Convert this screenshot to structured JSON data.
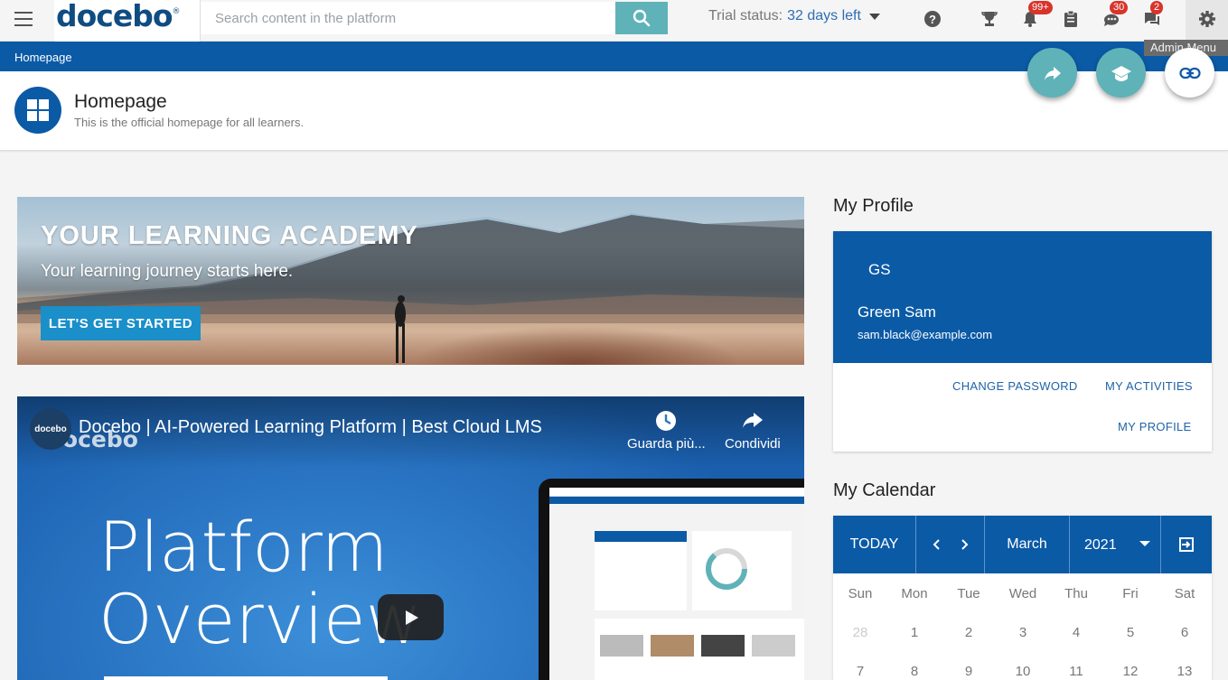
{
  "topbar": {
    "logo": "docebo",
    "logo_mark": "®",
    "search_placeholder": "Search content in the platform",
    "trial_label": "Trial status:",
    "trial_days": "32 days left",
    "badges": {
      "notifications": "99+",
      "chat": "30",
      "messages": "2"
    },
    "admin_tooltip": "Admin Menu"
  },
  "breadcrumb": {
    "home": "Homepage"
  },
  "header": {
    "title": "Homepage",
    "subtitle": "This is the official homepage for all learners."
  },
  "banner": {
    "title": "YOUR LEARNING ACADEMY",
    "subtitle": "Your learning journey starts here.",
    "cta": "LET'S GET STARTED"
  },
  "video": {
    "channel_logo": "docebo",
    "title": "Docebo | AI-Powered Learning Platform | Best Cloud LMS",
    "watch_later": "Guarda più...",
    "share": "Condividi",
    "big_line1": "Platform",
    "big_line2": "Overview"
  },
  "profile": {
    "section_title": "My Profile",
    "initials": "GS",
    "name": "Green Sam",
    "email": "sam.black@example.com",
    "change_password": "CHANGE PASSWORD",
    "my_activities": "MY ACTIVITIES",
    "my_profile": "MY PROFILE"
  },
  "calendar": {
    "section_title": "My Calendar",
    "today": "TODAY",
    "month": "March",
    "year": "2021",
    "weekdays": [
      "Sun",
      "Mon",
      "Tue",
      "Wed",
      "Thu",
      "Fri",
      "Sat"
    ],
    "week1": [
      "28",
      "1",
      "2",
      "3",
      "4",
      "5",
      "6"
    ],
    "week2": [
      "7",
      "8",
      "9",
      "10",
      "11",
      "12",
      "13"
    ]
  },
  "colors": {
    "brand_blue": "#0b5aa6",
    "accent_teal": "#5fb3b8",
    "badge_red": "#d9342b",
    "cta_blue": "#1a8fc9"
  },
  "icons": [
    "menu-icon",
    "search-icon",
    "help-icon",
    "trophy-icon",
    "bell-icon",
    "clipboard-icon",
    "chat-icon",
    "message-icon",
    "gear-icon",
    "share-icon",
    "graduation-cap-icon",
    "link-icon",
    "dashboard-icon",
    "clock-icon",
    "play-icon",
    "chevron-left-icon",
    "chevron-right-icon",
    "caret-down-icon",
    "export-icon"
  ]
}
